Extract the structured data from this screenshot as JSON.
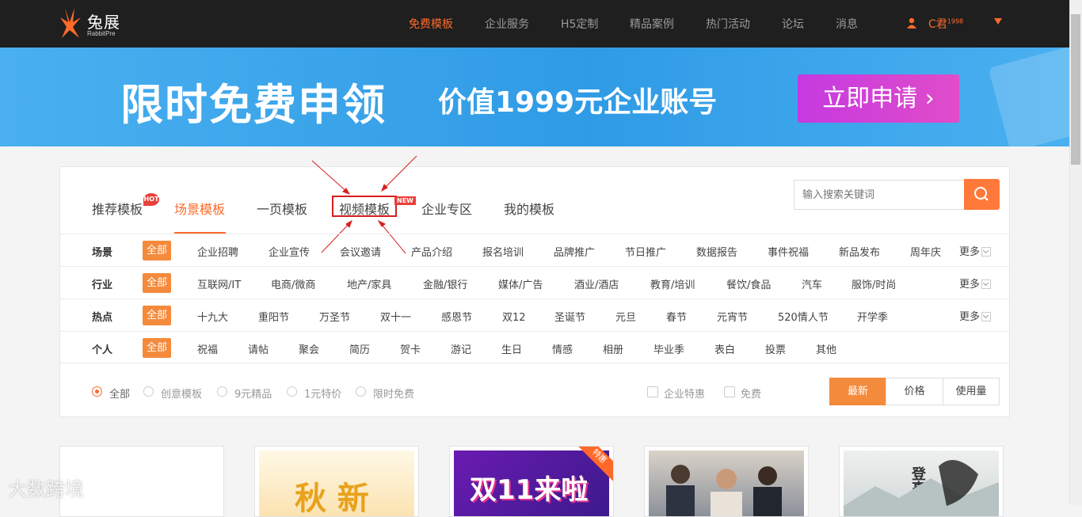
{
  "logo": {
    "name": "兔展",
    "sub": "RabbitPre"
  },
  "nav": {
    "items": [
      "免费模板",
      "企业服务",
      "H5定制",
      "精品案例",
      "热门活动",
      "论坛",
      "消息"
    ],
    "user": "C君",
    "user_sup": "1998"
  },
  "banner": {
    "title": "限时免费申领",
    "subtitle": "价值1999元企业账号",
    "button": "立即申请 ›"
  },
  "tabs": [
    "推荐模板",
    "场景模板",
    "一页模板",
    "视频模板",
    "企业专区",
    "我的模板"
  ],
  "badges": {
    "hot": "HOT",
    "new": "NEW"
  },
  "search": {
    "placeholder": "输入搜索关键词"
  },
  "filters": {
    "all_label": "全部",
    "more_label": "更多",
    "rows": [
      {
        "label": "场景",
        "items": [
          "企业招聘",
          "企业宣传",
          "会议邀请",
          "产品介绍",
          "报名培训",
          "品牌推广",
          "节日推广",
          "数据报告",
          "事件祝福",
          "新品发布",
          "周年庆"
        ]
      },
      {
        "label": "行业",
        "items": [
          "互联网/IT",
          "电商/微商",
          "地产/家具",
          "金融/银行",
          "媒体/广告",
          "酒业/酒店",
          "教育/培训",
          "餐饮/食品",
          "汽车",
          "服饰/时尚"
        ]
      },
      {
        "label": "热点",
        "items": [
          "十九大",
          "重阳节",
          "万圣节",
          "双十一",
          "感恩节",
          "双12",
          "圣诞节",
          "元旦",
          "春节",
          "元宵节",
          "520情人节",
          "开学季"
        ]
      },
      {
        "label": "个人",
        "items": [
          "祝福",
          "请帖",
          "聚会",
          "简历",
          "贺卡",
          "游记",
          "生日",
          "情感",
          "相册",
          "毕业季",
          "表白",
          "投票",
          "其他"
        ]
      }
    ]
  },
  "options": {
    "radios": [
      "全部",
      "创意模板",
      "9元精品",
      "1元特价",
      "限时免费"
    ],
    "checkboxes": [
      "企业特惠",
      "免费"
    ],
    "sort": [
      "最新",
      "价格",
      "使用量"
    ]
  },
  "cards": {
    "card2_text": "秋 新",
    "card3_text": "双11来啦",
    "card3_ribbon": "特惠",
    "card5_text": "登高望"
  },
  "watermark": "大数跨境",
  "colors": {
    "accent": "#ff6a2b",
    "banner": "#2f9be6",
    "button": "#d244d4",
    "highlight": "#d61f1f"
  }
}
